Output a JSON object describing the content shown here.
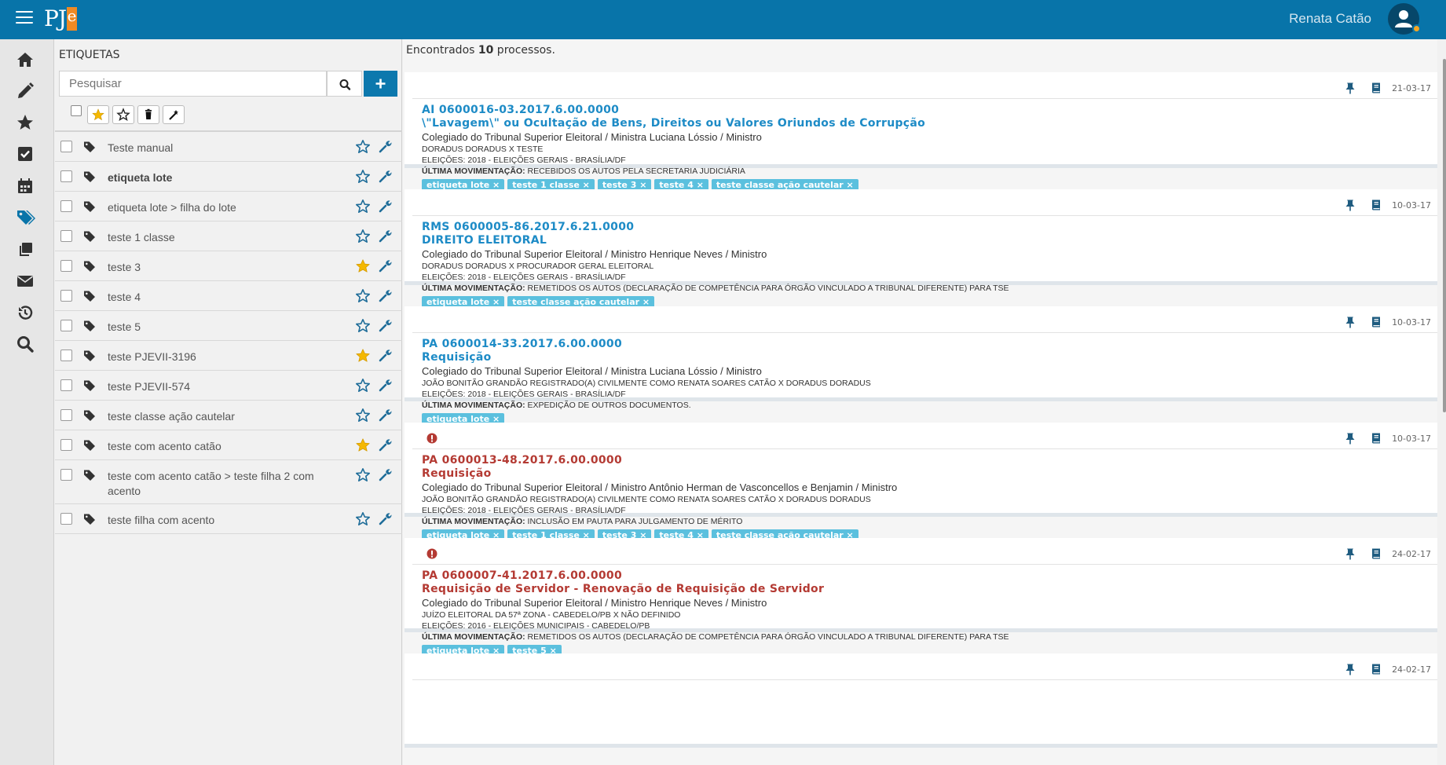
{
  "header": {
    "brand": "PJ",
    "brand_accent": "e",
    "user_name": "Renata Catão",
    "colors": {
      "bar": "#0874a9",
      "accent": "#f08a24"
    }
  },
  "sidenav": {
    "items": [
      {
        "icon": "home-icon"
      },
      {
        "icon": "pencil-icon"
      },
      {
        "icon": "star-icon"
      },
      {
        "icon": "checkbox-icon"
      },
      {
        "icon": "calendar-icon"
      },
      {
        "icon": "tags-icon",
        "active": true
      },
      {
        "icon": "copy-icon"
      },
      {
        "icon": "envelope-icon"
      },
      {
        "icon": "history-icon"
      },
      {
        "icon": "search-icon"
      }
    ]
  },
  "tags_panel": {
    "title": "ETIQUETAS",
    "search_placeholder": "Pesquisar",
    "tags": [
      {
        "label": "Teste manual",
        "bold": false,
        "favorite": false
      },
      {
        "label": "etiqueta lote",
        "bold": true,
        "favorite": false
      },
      {
        "label": "etiqueta lote > filha do lote",
        "bold": false,
        "favorite": false
      },
      {
        "label": "teste 1 classe",
        "bold": false,
        "favorite": false
      },
      {
        "label": "teste 3",
        "bold": false,
        "favorite": true
      },
      {
        "label": "teste 4",
        "bold": false,
        "favorite": false
      },
      {
        "label": "teste 5",
        "bold": false,
        "favorite": false
      },
      {
        "label": "teste PJEVII-3196",
        "bold": false,
        "favorite": true
      },
      {
        "label": "teste PJEVII-574",
        "bold": false,
        "favorite": false
      },
      {
        "label": "teste classe ação cautelar",
        "bold": false,
        "favorite": false
      },
      {
        "label": "teste com acento catão",
        "bold": false,
        "favorite": true
      },
      {
        "label": "teste com acento catão > teste filha 2 com acento",
        "bold": false,
        "favorite": false,
        "tall": true
      },
      {
        "label": "teste filha com acento",
        "bold": false,
        "favorite": false
      }
    ]
  },
  "results": {
    "prefix": "Encontrados ",
    "count": "10",
    "suffix": " processos.",
    "cards": [
      {
        "date": "21-03-17",
        "alert": false,
        "number": "AI 0600016-03.2017.6.00.0000",
        "class": "\\\"Lavagem\\\" ou Ocultação de Bens, Direitos ou Valores Oriundos de Corrupção",
        "orgao": "Colegiado do Tribunal Superior Eleitoral / Ministra Luciana Lóssio / Ministro",
        "partes": "DORADUS DORADUS X TESTE",
        "eleicao": "ELEIÇÕES: 2018 - ELEIÇÕES GERAIS - BRASÍLIA/DF",
        "mov_label": "ÚLTIMA MOVIMENTAÇÃO:",
        "mov": " RECEBIDOS OS AUTOS PELA SECRETARIA JUDICIÁRIA",
        "tags": [
          "etiqueta lote ×",
          "teste 1 classe ×",
          "teste 3 ×",
          "teste 4 ×",
          "teste classe ação cautelar ×"
        ]
      },
      {
        "date": "10-03-17",
        "alert": false,
        "number": "RMS 0600005-86.2017.6.21.0000",
        "class": "DIREITO ELEITORAL",
        "orgao": "Colegiado do Tribunal Superior Eleitoral / Ministro Henrique Neves / Ministro",
        "partes": "DORADUS DORADUS X PROCURADOR GERAL ELEITORAL",
        "eleicao": "ELEIÇÕES: 2018 - ELEIÇÕES GERAIS - BRASÍLIA/DF",
        "mov_label": "ÚLTIMA MOVIMENTAÇÃO:",
        "mov": " REMETIDOS OS AUTOS (DECLARAÇÃO DE COMPETÊNCIA PARA ÓRGÃO VINCULADO A TRIBUNAL DIFERENTE) PARA TSE",
        "tags": [
          "etiqueta lote ×",
          "teste classe ação cautelar ×"
        ]
      },
      {
        "date": "10-03-17",
        "alert": false,
        "number": "PA 0600014-33.2017.6.00.0000",
        "class": "Requisição",
        "orgao": "Colegiado do Tribunal Superior Eleitoral / Ministra Luciana Lóssio / Ministro",
        "partes": "JOÃO BONITÃO GRANDÃO REGISTRADO(A) CIVILMENTE COMO RENATA SOARES CATÃO X DORADUS DORADUS",
        "eleicao": "ELEIÇÕES: 2018 - ELEIÇÕES GERAIS - BRASÍLIA/DF",
        "mov_label": "ÚLTIMA MOVIMENTAÇÃO:",
        "mov": " EXPEDIÇÃO DE OUTROS DOCUMENTOS.",
        "tags": [
          "etiqueta lote ×"
        ]
      },
      {
        "date": "10-03-17",
        "alert": true,
        "number": "PA 0600013-48.2017.6.00.0000",
        "class": "Requisição",
        "orgao": "Colegiado do Tribunal Superior Eleitoral / Ministro Antônio Herman de Vasconcellos e Benjamin / Ministro",
        "partes": "JOÃO BONITÃO GRANDÃO REGISTRADO(A) CIVILMENTE COMO RENATA SOARES CATÃO X DORADUS DORADUS",
        "eleicao": "ELEIÇÕES: 2018 - ELEIÇÕES GERAIS - BRASÍLIA/DF",
        "mov_label": "ÚLTIMA MOVIMENTAÇÃO:",
        "mov": " INCLUSÃO EM PAUTA PARA JULGAMENTO DE MÉRITO",
        "tags": [
          "etiqueta lote ×",
          "teste 1 classe ×",
          "teste 3 ×",
          "teste 4 ×",
          "teste classe ação cautelar ×"
        ]
      },
      {
        "date": "24-02-17",
        "alert": true,
        "number": "PA 0600007-41.2017.6.00.0000",
        "class": "Requisição de Servidor - Renovação de Requisição de Servidor",
        "orgao": "Colegiado do Tribunal Superior Eleitoral / Ministro Henrique Neves / Ministro",
        "partes": "JUÍZO ELEITORAL DA 57ª ZONA - CABEDELO/PB X NÃO DEFINIDO",
        "eleicao": "ELEIÇÕES: 2016 - ELEIÇÕES MUNICIPAIS - CABEDELO/PB",
        "mov_label": "ÚLTIMA MOVIMENTAÇÃO:",
        "mov": " REMETIDOS OS AUTOS (DECLARAÇÃO DE COMPETÊNCIA PARA ÓRGÃO VINCULADO A TRIBUNAL DIFERENTE) PARA TSE",
        "tags": [
          "etiqueta lote ×",
          "teste 5 ×"
        ]
      },
      {
        "date": "24-02-17",
        "alert": false,
        "number": "",
        "class": "",
        "orgao": "",
        "partes": "",
        "eleicao": "",
        "mov_label": "",
        "mov": "",
        "tags": []
      }
    ]
  }
}
